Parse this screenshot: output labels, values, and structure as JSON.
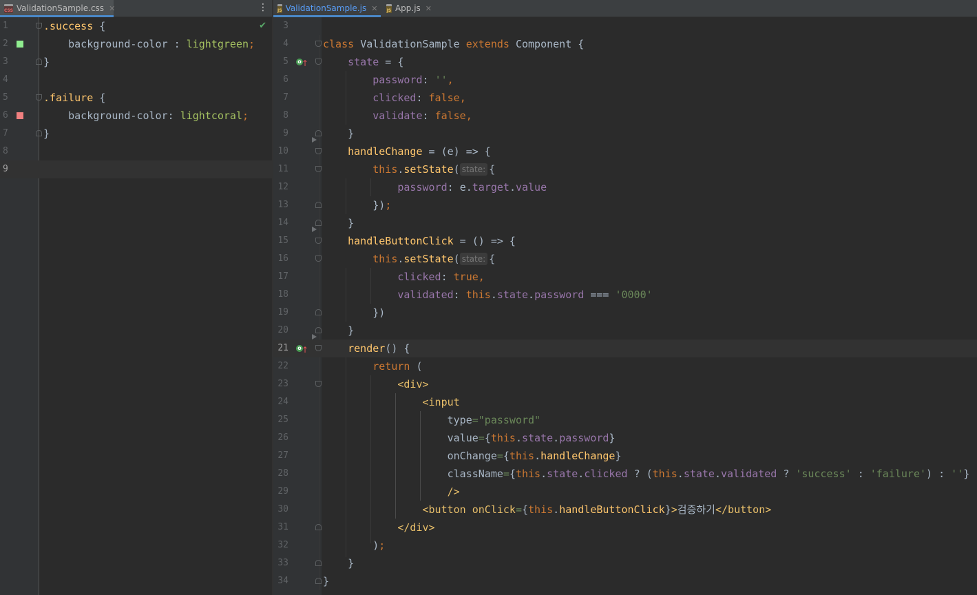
{
  "left_tabs": [
    {
      "label": "ValidationSample.css",
      "icon": "css-file-icon"
    }
  ],
  "right_tabs": [
    {
      "label": "ValidationSample.js",
      "icon": "js-file-icon",
      "active": true
    },
    {
      "label": "App.js",
      "icon": "js-file-icon",
      "active": false
    }
  ],
  "icons": {
    "close": "✕",
    "more": "⋮",
    "check": "✔",
    "override": "o",
    "up_arrow": "↑"
  },
  "css_file": {
    "lines": [
      {
        "n": "1",
        "a": ".success",
        "b": " {"
      },
      {
        "n": "2",
        "a": "    background-color",
        "b": " : ",
        "c": "lightgreen",
        "d": ";"
      },
      {
        "n": "3",
        "a": "}"
      },
      {
        "n": "4"
      },
      {
        "n": "5",
        "a": ".failure",
        "b": " {"
      },
      {
        "n": "6",
        "a": "    background-color",
        "b": ": ",
        "c": "lightcoral",
        "d": ";"
      },
      {
        "n": "7",
        "a": "}"
      },
      {
        "n": "8"
      },
      {
        "n": "9"
      }
    ],
    "swatches": {
      "lightgreen": "#90ee90",
      "lightcoral": "#f08080"
    }
  },
  "js_file": {
    "line_numbers": [
      "3",
      "4",
      "5",
      "6",
      "7",
      "8",
      "9",
      "10",
      "11",
      "12",
      "13",
      "14",
      "15",
      "16",
      "17",
      "18",
      "19",
      "20",
      "21",
      "22",
      "23",
      "24",
      "25",
      "26",
      "27",
      "28",
      "29",
      "30",
      "31",
      "32",
      "33",
      "34"
    ],
    "tokens": {
      "class_kw": "class",
      "class_name": "ValidationSample",
      "extends_kw": "extends",
      "base": "Component",
      "lbrace": "{",
      "state": "state",
      "assign_brace": " = {",
      "password_key": "password",
      "empty_str": "''",
      "comma": ",",
      "clicked_key": "clicked",
      "false_val": "false",
      "validate_key": "validate",
      "rbrace": "}",
      "handle_change": "handleChange",
      "arrow_e": " = (e) => {",
      "this_kw": "this",
      "set_state": "setState",
      "paren": "(",
      "state_hint": "state:",
      "brace_open": "{",
      "e_target": "e",
      "target": "target",
      "value": "value",
      "close_call": "})",
      "semi": ";",
      "handle_button_click": "handleButtonClick",
      "arrow_empty": " = () => {",
      "true_val": "true",
      "validated_key": "validated",
      "password_prop": "password",
      "triple_eq": "===",
      "zero_str": "'0000'",
      "render": "render",
      "render_rest": "() {",
      "return_kw": "return",
      "lparen": "(",
      "div_open": "<div>",
      "input_open": "<input",
      "type_attr": "type",
      "eq": "=",
      "password_str": "\"password\"",
      "value_attr": "value",
      "onchange_attr": "onChange",
      "classname_attr": "className",
      "qmark": "?",
      "colon": ":",
      "success_str": "'success'",
      "failure_str": "'failure'",
      "empty_str2": "''",
      "self_close": "/>",
      "button_open": "<button",
      "onclick_attr": "onClick",
      "gt": ">",
      "button_text": "검증하기",
      "button_close": "</button>",
      "div_close": "</div>",
      "rparen": ")"
    }
  }
}
